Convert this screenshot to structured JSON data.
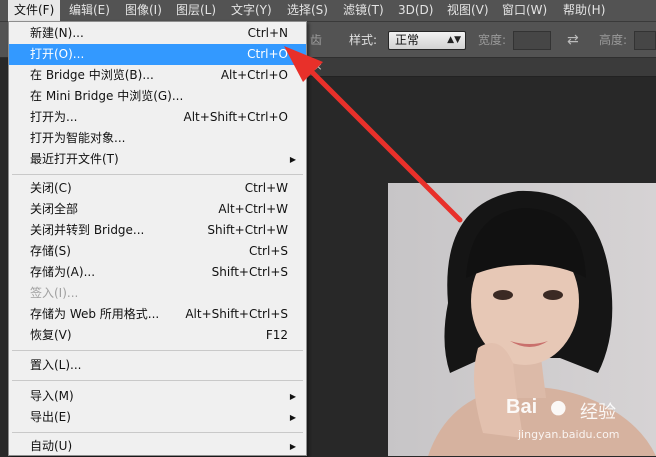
{
  "menubar": {
    "items": [
      {
        "label": "文件(F)"
      },
      {
        "label": "编辑(E)"
      },
      {
        "label": "图像(I)"
      },
      {
        "label": "图层(L)"
      },
      {
        "label": "文字(Y)"
      },
      {
        "label": "选择(S)"
      },
      {
        "label": "滤镜(T)"
      },
      {
        "label": "3D(D)"
      },
      {
        "label": "视图(V)"
      },
      {
        "label": "窗口(W)"
      },
      {
        "label": "帮助(H)"
      }
    ]
  },
  "options": {
    "partial_label": "齿",
    "style_label": "样式:",
    "style_value": "正常",
    "width_label": "宽度:",
    "height_label": "高度:"
  },
  "document_tab": {
    "close_glyph": "×"
  },
  "file_menu": {
    "items": [
      {
        "label": "新建(N)...",
        "shortcut": "Ctrl+N"
      },
      {
        "label": "打开(O)...",
        "shortcut": "Ctrl+O"
      },
      {
        "label": "在 Bridge 中浏览(B)...",
        "shortcut": "Alt+Ctrl+O"
      },
      {
        "label": "在 Mini Bridge 中浏览(G)...",
        "shortcut": ""
      },
      {
        "label": "打开为...",
        "shortcut": "Alt+Shift+Ctrl+O"
      },
      {
        "label": "打开为智能对象...",
        "shortcut": ""
      },
      {
        "label": "最近打开文件(T)",
        "shortcut": ""
      },
      {
        "label": "关闭(C)",
        "shortcut": "Ctrl+W"
      },
      {
        "label": "关闭全部",
        "shortcut": "Alt+Ctrl+W"
      },
      {
        "label": "关闭并转到 Bridge...",
        "shortcut": "Shift+Ctrl+W"
      },
      {
        "label": "存储(S)",
        "shortcut": "Ctrl+S"
      },
      {
        "label": "存储为(A)...",
        "shortcut": "Shift+Ctrl+S"
      },
      {
        "label": "签入(I)...",
        "shortcut": ""
      },
      {
        "label": "存储为 Web 所用格式...",
        "shortcut": "Alt+Shift+Ctrl+S"
      },
      {
        "label": "恢复(V)",
        "shortcut": "F12"
      },
      {
        "label": "置入(L)...",
        "shortcut": ""
      },
      {
        "label": "导入(M)",
        "shortcut": ""
      },
      {
        "label": "导出(E)",
        "shortcut": ""
      },
      {
        "label": "自动(U)",
        "shortcut": ""
      }
    ]
  },
  "watermark": {
    "brand_left": "Bai",
    "brand_right": "经验",
    "url": "jingyan.baidu.com"
  },
  "colors": {
    "highlight": "#3399ff",
    "arrow": "#e8302a",
    "menu_bg": "#f0f0f0",
    "chrome": "#535353"
  }
}
